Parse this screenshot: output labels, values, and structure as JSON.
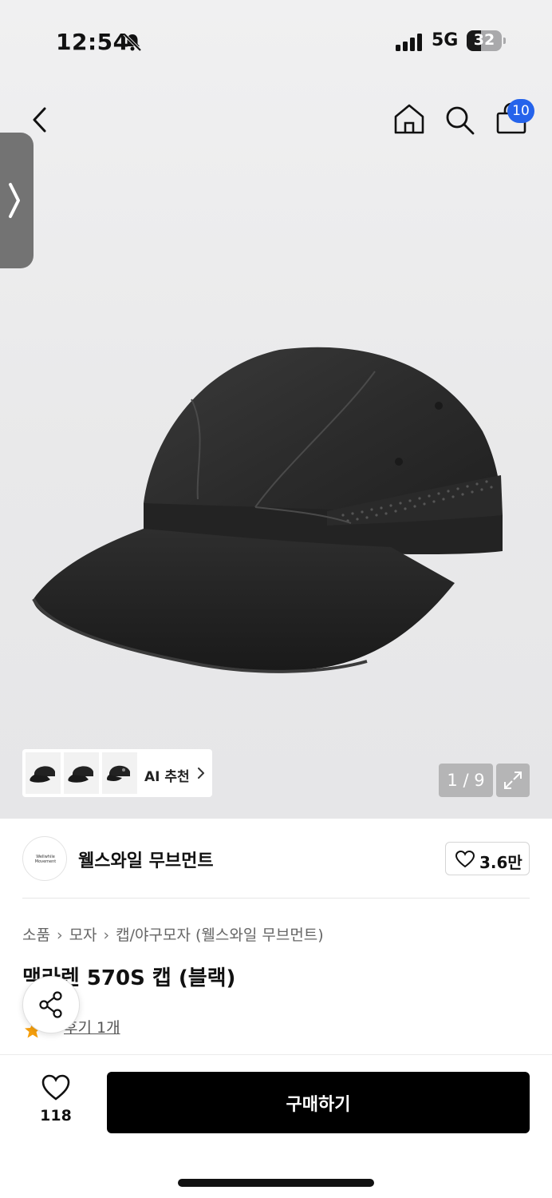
{
  "status_bar": {
    "time": "12:54",
    "network": "5G",
    "battery": "32"
  },
  "nav": {
    "cart_count": "10"
  },
  "gallery": {
    "counter": "1 / 9",
    "ai_label": "AI 추천"
  },
  "brand": {
    "name": "웰스와일 무브먼트",
    "likes": "3.6만",
    "logo_text": "Wellwhile Movement"
  },
  "breadcrumb": [
    "소품",
    "모자",
    "캡/야구모자 (웰스와일 무브먼트)"
  ],
  "product": {
    "title": "맥라렌 570S 캡 (블랙)",
    "reviews": "후기 1개"
  },
  "bottom_bar": {
    "wish_count": "118",
    "buy_label": "구매하기"
  },
  "colors": {
    "accent_badge": "#2563eb",
    "buy_button": "#000000",
    "star": "#f59e0b"
  },
  "icons": [
    "chevron-left-icon",
    "home-icon",
    "search-icon",
    "shopping-bag-icon",
    "chevron-right-icon",
    "expand-icon",
    "heart-icon",
    "share-icon",
    "star-icon"
  ]
}
